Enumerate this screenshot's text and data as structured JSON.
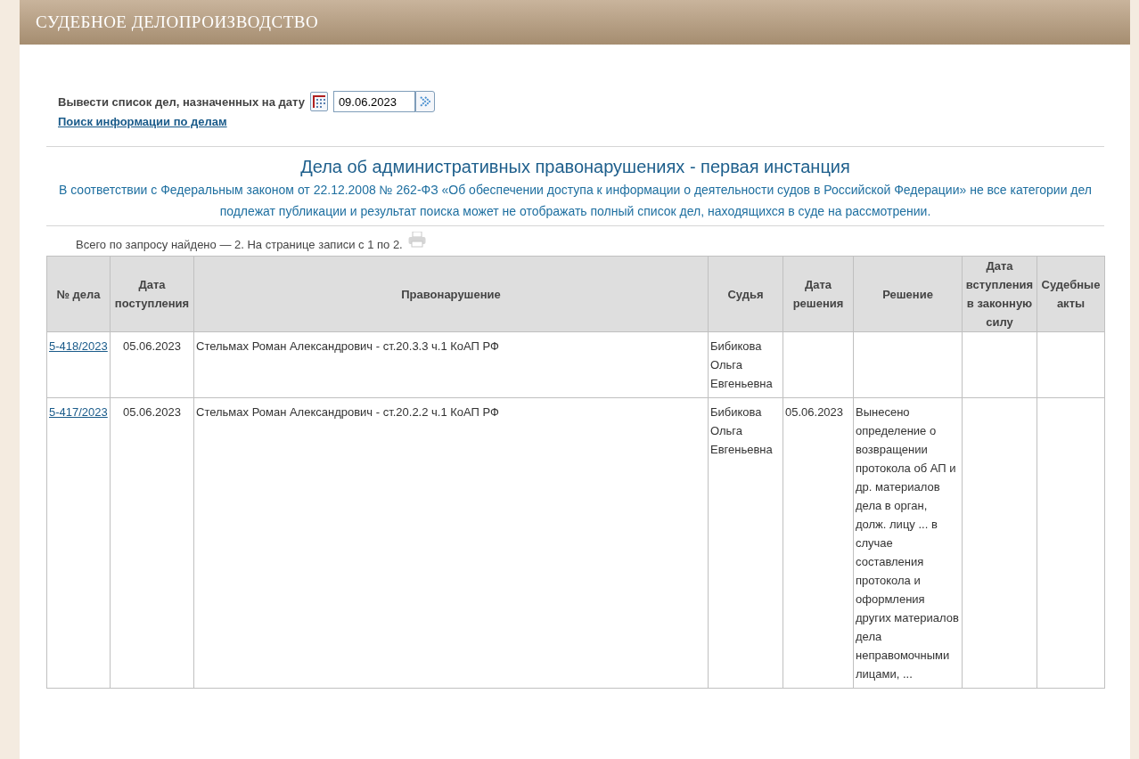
{
  "header": {
    "title": "СУДЕБНОЕ ДЕЛОПРОИЗВОДСТВО"
  },
  "date_filter": {
    "label": "Вывести список дел, назначенных на дату",
    "value": "09.06.2023"
  },
  "search_link": "Поиск информации по делам",
  "section": {
    "title": "Дела об административных правонарушениях - первая инстанция",
    "notice": "В соответствии с Федеральным законом от 22.12.2008 № 262-ФЗ «Об обеспечении доступа к информации о деятельности судов в Российской Федерации» не все категории дел подлежат публикации и результат поиска может не отображать полный список дел, находящихся в суде на рассмотрении."
  },
  "result_summary": "Всего по запросу найдено — 2. На странице записи с 1 по 2.",
  "table": {
    "columns": [
      "№ дела",
      "Дата поступления",
      "Правонарушение",
      "Судья",
      "Дата решения",
      "Решение",
      "Дата вступления в законную силу",
      "Судебные акты"
    ],
    "rows": [
      {
        "case_number": "5-418/2023",
        "received": "05.06.2023",
        "offense": "Стельмах Роман Александрович - ст.20.3.3 ч.1 КоАП РФ",
        "judge": "Бибикова Ольга Евгеньевна",
        "decision_date": "",
        "decision": ""
      },
      {
        "case_number": "5-417/2023",
        "received": "05.06.2023",
        "offense": "Стельмах Роман Александрович - ст.20.2.2 ч.1 КоАП РФ",
        "judge": "Бибикова Ольга Евгеньевна",
        "decision_date": "05.06.2023",
        "decision": "Вынесено определение о возвращении протокола об АП и др. материалов дела в орган, долж. лицу ... в случае составления протокола и оформления других материалов дела неправомочными лицами, ..."
      }
    ]
  }
}
